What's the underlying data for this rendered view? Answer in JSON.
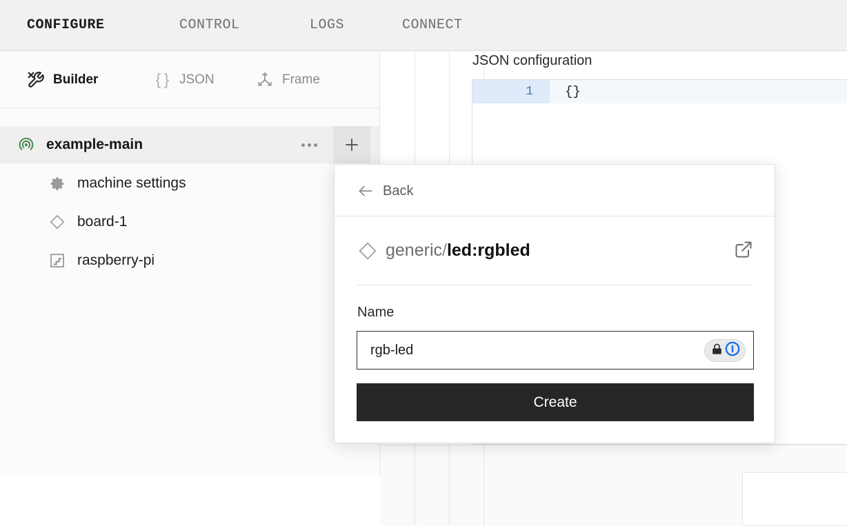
{
  "topnav": {
    "tabs": [
      {
        "label": "CONFIGURE",
        "active": true
      },
      {
        "label": "CONTROL",
        "active": false
      },
      {
        "label": "LOGS",
        "active": false
      },
      {
        "label": "CONNECT",
        "active": false
      }
    ]
  },
  "left_panel": {
    "modes": [
      {
        "label": "Builder",
        "icon": "tools-icon",
        "active": true
      },
      {
        "label": "JSON",
        "icon": "braces-icon",
        "active": false
      },
      {
        "label": "Frame",
        "icon": "axes-icon",
        "active": false
      }
    ],
    "tree": {
      "root": {
        "label": "example-main",
        "icon": "viam-radar-icon",
        "menu_icon": "ellipsis-icon",
        "add_icon": "plus-icon"
      },
      "children": [
        {
          "label": "machine settings",
          "icon": "gear-icon"
        },
        {
          "label": "board-1",
          "icon": "diamond-icon"
        },
        {
          "label": "raspberry-pi",
          "icon": "board-chip-icon"
        }
      ]
    }
  },
  "main": {
    "json_config_label": "JSON configuration",
    "editor": {
      "lines": [
        {
          "number": "1",
          "text": "{}"
        }
      ]
    }
  },
  "modal": {
    "back_label": "Back",
    "back_icon": "arrow-left-icon",
    "type_icon": "diamond-icon",
    "namespace": "generic",
    "separator": "/",
    "model": "led:rgbled",
    "external_link_icon": "external-link-icon",
    "name_field_label": "Name",
    "name_value": "rgb-led",
    "name_placeholder": "Name",
    "password_manager": {
      "lock_icon": "lock-icon",
      "brand_icon": "onepassword-icon",
      "brand_color": "#1a73e8"
    },
    "create_label": "Create"
  },
  "colors": {
    "accent_green": "#4a8a4f",
    "button_dark": "#262626",
    "gutter_blue": "#dfeafa",
    "line_number": "#4a7aa7"
  }
}
